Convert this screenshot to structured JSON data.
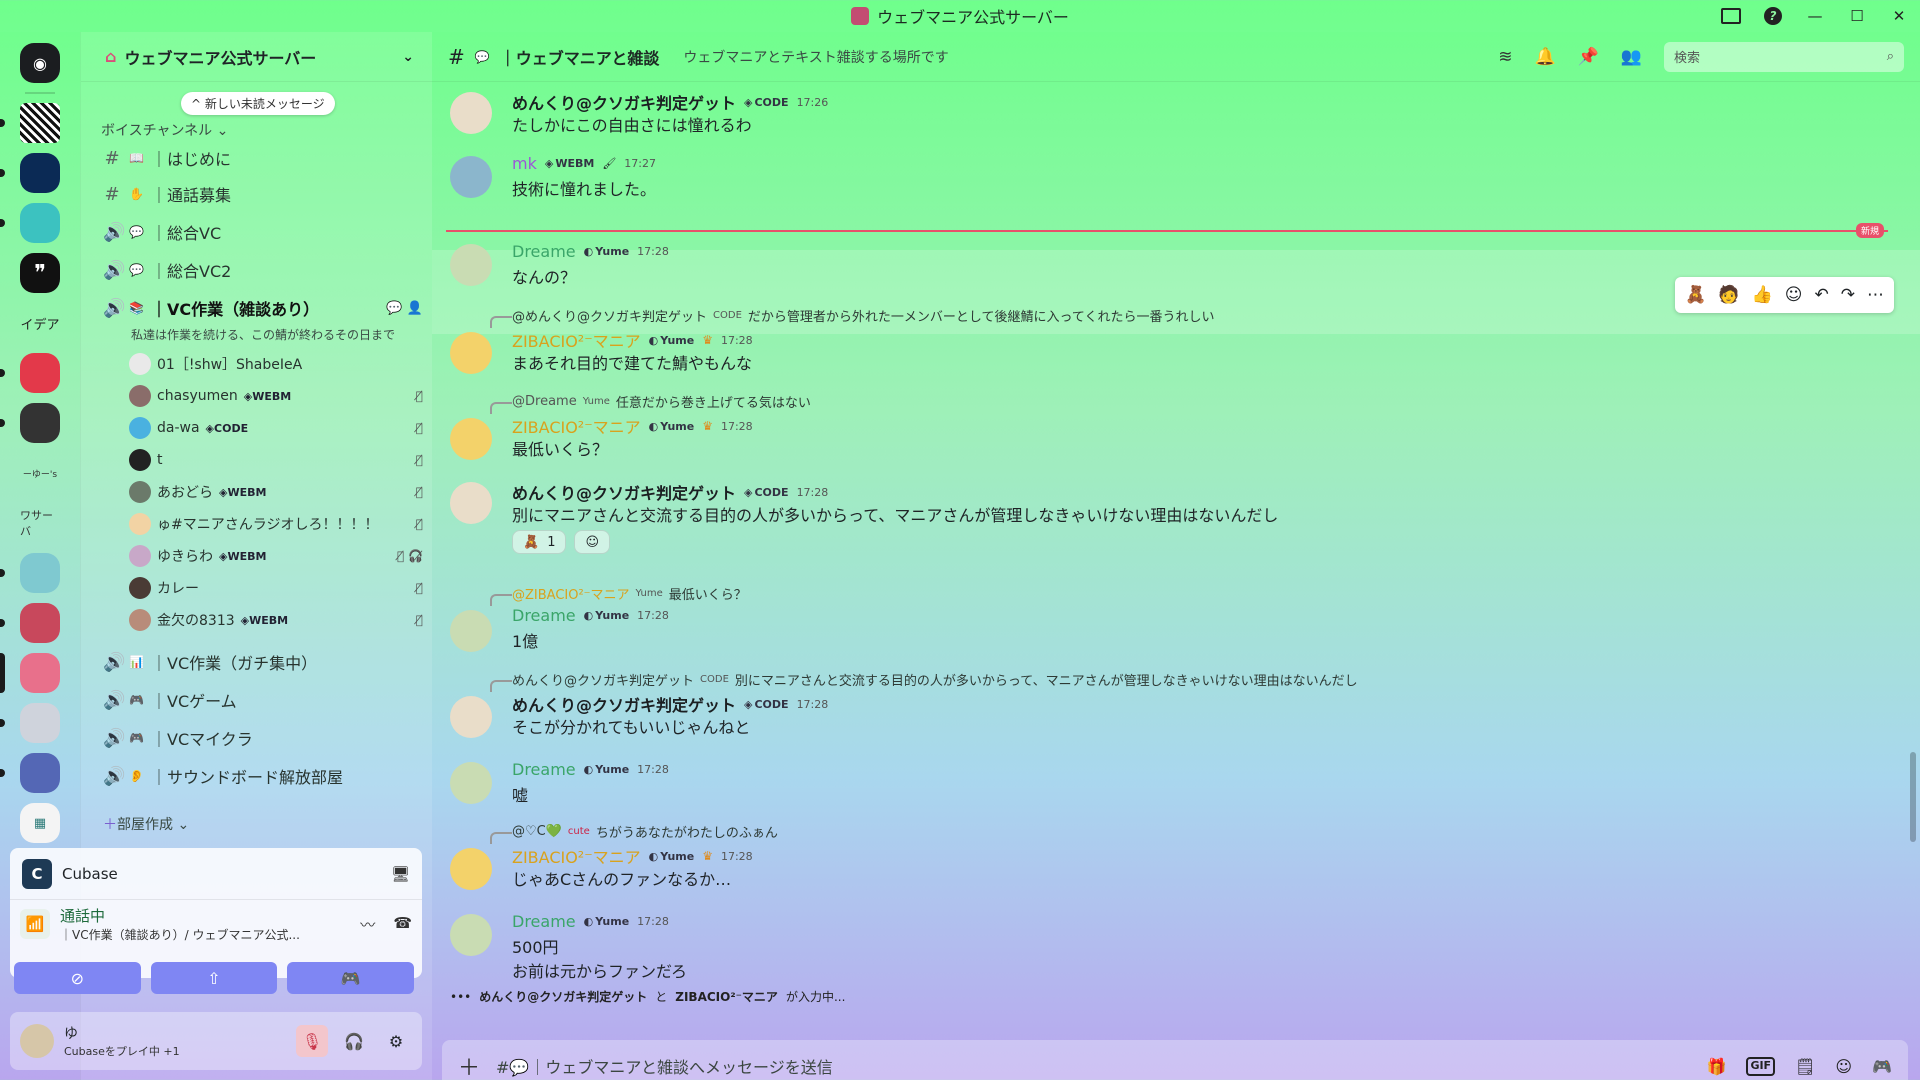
{
  "window": {
    "title": "ウェブマニア公式サーバー"
  },
  "servers": [
    {
      "name": "Discord",
      "label": ""
    },
    {
      "name": "QR",
      "label": ""
    },
    {
      "name": "Blue",
      "label": ""
    },
    {
      "name": "Miku",
      "label": ""
    },
    {
      "name": "Quote",
      "label": "❞"
    },
    {
      "name": "Idea",
      "label": "イデア"
    },
    {
      "name": "Discord2",
      "label": ""
    },
    {
      "name": "Dark",
      "label": ""
    },
    {
      "name": "Yuu",
      "label": "ーゆー's"
    },
    {
      "name": "Server",
      "label": "ワサーバ"
    }
  ],
  "server_header": {
    "name": "ウェブマニア公式サーバー"
  },
  "unread_pill": "^ 新しい未読メッセージ",
  "voice_category": "ボイスチャンネル",
  "channels": [
    {
      "icon": "#",
      "label": "｜はじめに"
    },
    {
      "icon": "#",
      "label": "｜通話募集"
    },
    {
      "icon": "🔊",
      "label": "｜総合VC"
    },
    {
      "icon": "🔊",
      "label": "｜総合VC2"
    },
    {
      "icon": "🔊",
      "label": "｜VC作業（雑談あり）",
      "desc": "私達は作業を続ける、この鯖が終わるその日まで"
    }
  ],
  "voice_users": [
    {
      "name": "01［!shw］ShabeIeA",
      "badge": ""
    },
    {
      "name": "chasyumen",
      "badge": "WEBM"
    },
    {
      "name": "da-wa",
      "badge": "CODE"
    },
    {
      "name": "t",
      "badge": ""
    },
    {
      "name": "あおどら",
      "badge": "WEBM"
    },
    {
      "name": "ゅ#マニアさんラジオしろ！！！！",
      "badge": ""
    },
    {
      "name": "ゆきらわ",
      "badge": "WEBM"
    },
    {
      "name": "カレー",
      "badge": ""
    },
    {
      "name": "金欠の8313",
      "badge": "WEBM"
    }
  ],
  "channels2": [
    {
      "label": "｜VC作業（ガチ集中）"
    },
    {
      "label": "｜VCゲーム"
    },
    {
      "label": "｜VCマイクラ"
    },
    {
      "label": "｜サウンドボード解放部屋"
    }
  ],
  "create_room": "部屋作成",
  "activity": {
    "app": "Cubase"
  },
  "voice_status": {
    "title": "通話中",
    "detail": "｜VC作業（雑談あり）/ ウェブマニア公式..."
  },
  "user": {
    "name": "ゆ",
    "status": "Cubaseをプレイ中 +1"
  },
  "channel_topbar": {
    "name": "｜ウェブマニアと雑談",
    "topic": "ウェブマニアとテキスト雑談する場所です",
    "search_placeholder": "検索"
  },
  "new_label": "新規",
  "messages": [
    {
      "name": "めんくり@クソガキ判定ゲット",
      "tag": "CODE",
      "time": "17:26",
      "body": "たしかにこの自由さには憧れるわ"
    },
    {
      "name": "mk",
      "tag": "WEBM",
      "time": "17:27",
      "body": "技術に憧れました。"
    },
    {
      "name": "Dreame",
      "tag": "Yume",
      "time": "17:28",
      "body": "なんの？"
    },
    {
      "reply_name": "@めんくり@クソガキ判定ゲット",
      "reply_tag": "CODE",
      "reply_text": "だから管理者から外れた一メンバーとして後継鯖に入ってくれたら一番うれしい",
      "name": "ZIBACIO²⁻マニア",
      "tag": "Yume",
      "time": "17:28",
      "body": "まあそれ目的で建てた鯖やもんな"
    },
    {
      "reply_name": "@Dreame",
      "reply_tag": "Yume",
      "reply_text": "任意だから巻き上げてる気はない",
      "name": "ZIBACIO²⁻マニア",
      "tag": "Yume",
      "time": "17:28",
      "body": "最低いくら？"
    },
    {
      "name": "めんくり@クソガキ判定ゲット",
      "tag": "CODE",
      "time": "17:28",
      "body": "別にマニアさんと交流する目的の人が多いからって、マニアさんが管理しなきゃいけない理由はないんだし",
      "reaction_count": "1"
    },
    {
      "reply_name": "@ZIBACIO²⁻マニア",
      "reply_tag": "Yume",
      "reply_text": "最低いくら？",
      "name": "Dreame",
      "tag": "Yume",
      "time": "17:28",
      "body": "1億"
    },
    {
      "reply_name": "めんくり@クソガキ判定ゲット",
      "reply_tag": "CODE",
      "reply_text": "別にマニアさんと交流する目的の人が多いからって、マニアさんが管理しなきゃいけない理由はないんだし",
      "name": "めんくり@クソガキ判定ゲット",
      "tag": "CODE",
      "time": "17:28",
      "body": "そこが分かれてもいいじゃんねと"
    },
    {
      "name": "Dreame",
      "tag": "Yume",
      "time": "17:28",
      "body": "嘘"
    },
    {
      "reply_name": "@♡C💚",
      "reply_tag": "cute",
      "reply_text": "ちがうあなたがわたしのふぁん",
      "name": "ZIBACIO²⁻マニア",
      "tag": "Yume",
      "time": "17:28",
      "body": "じゃあCさんのファンなるか…"
    },
    {
      "name": "Dreame",
      "tag": "Yume",
      "time": "17:28",
      "body": "500円",
      "body2": "お前は元からファンだろ"
    }
  ],
  "typing": {
    "user1": "めんくり@クソガキ判定ゲット",
    "and": "と",
    "user2": "ZIBACIO²⁻マニア",
    "suffix": "が入力中..."
  },
  "composer": {
    "placeholder": "#💬｜ウェブマニアと雑談へメッセージを送信",
    "gif": "GIF"
  },
  "colors": {
    "accent": "#7f86f3",
    "new_line": "#e8506a",
    "dreame": "#3aa569",
    "ziba": "#d9a21d"
  }
}
